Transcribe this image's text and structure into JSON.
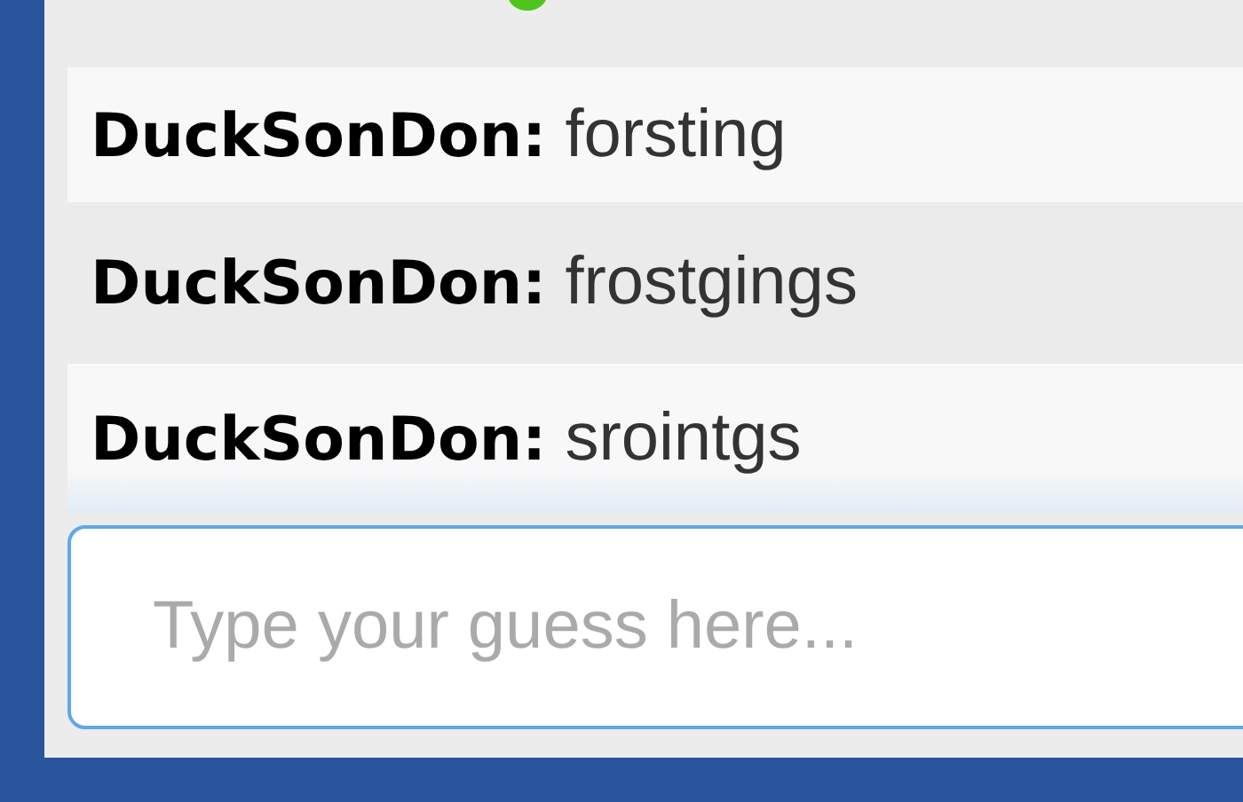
{
  "messages": [
    {
      "text": "**DuckSonDon:** forsting"
    },
    {
      "text": "**DuckSonDon:** frostgings"
    },
    {
      "text": "**DuckSonDon:** srointgs"
    }
  ],
  "guess_input": {
    "placeholder": "Type your guess here..."
  }
}
